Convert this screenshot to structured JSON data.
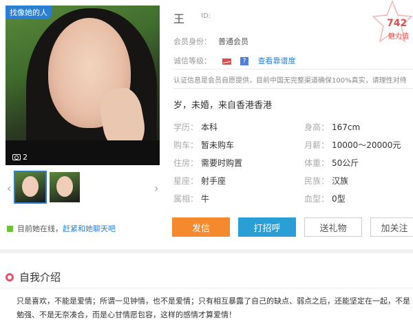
{
  "profile": {
    "find_similar_label": "找像她的人",
    "photo_count": "2",
    "name_masked": "王",
    "id_label": "ID:",
    "charm_score": "742",
    "charm_label": "魅力值",
    "member_label": "会员身份：",
    "member_value": "普通会员",
    "credit_label": "诚信等级：",
    "credit_link": "查看靠谱度",
    "note": "认证信息是会员自愿提供，目前中国无完整渠道确保100%真实，请理性对待",
    "summary": "岁，未婚，来自香港香港",
    "online_text": "目前她在线，",
    "online_link": "赶紧和她聊天吧"
  },
  "details": [
    {
      "key": "学历：",
      "value": "本科"
    },
    {
      "key": "身高：",
      "value": "167cm"
    },
    {
      "key": "购车：",
      "value": "暂未购车"
    },
    {
      "key": "月薪：",
      "value": "10000～20000元"
    },
    {
      "key": "住房：",
      "value": "需要时购置"
    },
    {
      "key": "体重：",
      "value": "50公斤"
    },
    {
      "key": "星座：",
      "value": "射手座"
    },
    {
      "key": "民族：",
      "value": "汉族"
    },
    {
      "key": "属相：",
      "value": "牛"
    },
    {
      "key": "血型：",
      "value": "0型"
    }
  ],
  "actions": {
    "send": "发信",
    "hello": "打招呼",
    "gift": "送礼物",
    "follow": "加关注"
  },
  "intro": {
    "title": "自我介绍",
    "text": "只是喜欢，不能是爱情；所谓一见钟情，也不是爱情；只有相互暴露了自己的缺点、弱点之后，还能坚定在一起，不是勉强、不是无奈凑合，而是心甘情愿包容，这样的感情才算爱情！"
  },
  "colors": {
    "accent_blue": "#2a7fd4",
    "send_orange": "#f5892d",
    "hello_blue": "#2a9fd6",
    "charm_red": "#e24b4b"
  }
}
